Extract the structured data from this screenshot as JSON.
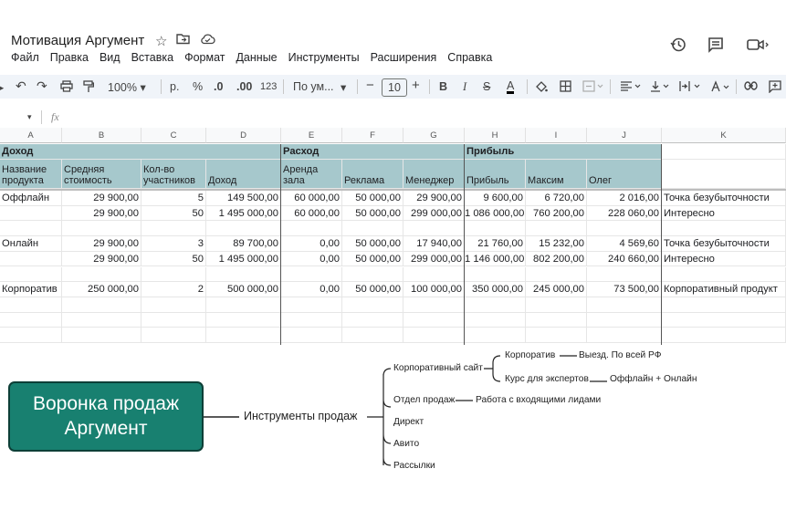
{
  "doc": {
    "title": "Мотивация Аргумент",
    "menu": [
      "Файл",
      "Правка",
      "Вид",
      "Вставка",
      "Формат",
      "Данные",
      "Инструменты",
      "Расширения",
      "Справка"
    ]
  },
  "toolbar": {
    "zoom": "100%",
    "currency": "р.",
    "percent": "%",
    "dec_decrease": ".0",
    "dec_increase": ".00",
    "number_format": "123",
    "font": "По ум...",
    "font_size": "10"
  },
  "formula_bar": {
    "fx": "fx"
  },
  "columns": [
    "A",
    "B",
    "C",
    "D",
    "E",
    "F",
    "G",
    "H",
    "I",
    "J",
    "K"
  ],
  "group_headers": {
    "income": "Доход",
    "expense": "Расход",
    "profit": "Прибыль"
  },
  "sub_headers": [
    "Название продукта",
    "Средняя стоимость",
    "Кол-во участников",
    "Доход",
    "Аренда зала",
    "Реклама",
    "Менеджер",
    "Прибыль",
    "Максим",
    "Олег",
    ""
  ],
  "rows": [
    [
      "Оффлайн",
      "29 900,00",
      "5",
      "149 500,00",
      "60 000,00",
      "50 000,00",
      "29 900,00",
      "9 600,00",
      "6 720,00",
      "2 016,00",
      "Точка безубыточности"
    ],
    [
      "",
      "29 900,00",
      "50",
      "1 495 000,00",
      "60 000,00",
      "50 000,00",
      "299 000,00",
      "1 086 000,00",
      "760 200,00",
      "228 060,00",
      "Интересно"
    ],
    [
      "",
      "",
      "",
      "",
      "",
      "",
      "",
      "",
      "",
      "",
      ""
    ],
    [
      "Онлайн",
      "29 900,00",
      "3",
      "89 700,00",
      "0,00",
      "50 000,00",
      "17 940,00",
      "21 760,00",
      "15 232,00",
      "4 569,60",
      "Точка безубыточности"
    ],
    [
      "",
      "29 900,00",
      "50",
      "1 495 000,00",
      "0,00",
      "50 000,00",
      "299 000,00",
      "1 146 000,00",
      "802 200,00",
      "240 660,00",
      "Интересно"
    ],
    [
      "",
      "",
      "",
      "",
      "",
      "",
      "",
      "",
      "",
      "",
      ""
    ],
    [
      "Корпоратив",
      "250 000,00",
      "2",
      "500 000,00",
      "0,00",
      "50 000,00",
      "100 000,00",
      "350 000,00",
      "245 000,00",
      "73 500,00",
      "Корпоративный продукт"
    ]
  ],
  "mindmap": {
    "root": "Воронка продаж Аргумент",
    "root_line1": "Воронка продаж",
    "root_line2": "Аргумент",
    "hub": "Инструменты продаж",
    "branches": {
      "corp_site": "Корпоративный сайт",
      "corporate": "Корпоратив",
      "corporate_leaf": "Выезд. По всей РФ",
      "expert_course": "Курс для экспертов",
      "expert_leaf": "Оффлайн + Онлайн",
      "sales_dept": "Отдел продаж",
      "sales_leaf": "Работа с входящими лидами",
      "direct": "Директ",
      "avito": "Авито",
      "mailings": "Рассылки"
    }
  }
}
